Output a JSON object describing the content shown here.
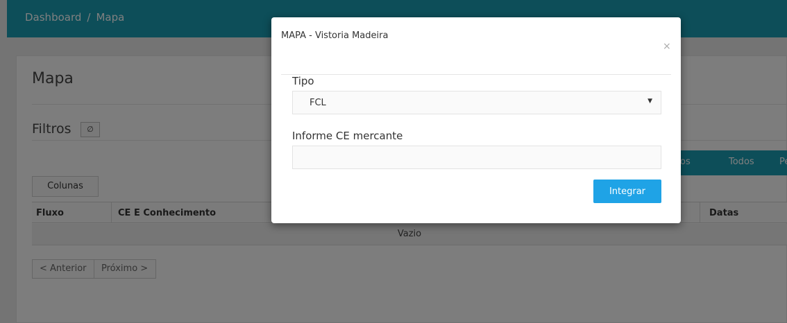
{
  "breadcrumb": {
    "home": "Dashboard",
    "separator": "/",
    "current": "Mapa"
  },
  "page": {
    "title": "Mapa",
    "filters_label": "Filtros",
    "filter_toggle_icon": "eye-slash-icon"
  },
  "right_buttons": {
    "partial": "os",
    "todos": "Todos",
    "more": "Pe"
  },
  "columns_button": "Colunas",
  "table": {
    "headers": [
      "Fluxo",
      "CE E Conhecimento",
      "Datas"
    ],
    "empty_text": "Vazio"
  },
  "pagination": {
    "prev": "< Anterior",
    "next": "Próximo >"
  },
  "modal": {
    "title": "MAPA - Vistoria Madeira",
    "close_symbol": "×",
    "tipo_label": "Tipo",
    "tipo_value": "FCL",
    "ce_label": "Informe CE mercante",
    "ce_value": "",
    "submit_label": "Integrar"
  },
  "colors": {
    "header": "#1a9cb3",
    "primary_button": "#1fa3e6"
  }
}
